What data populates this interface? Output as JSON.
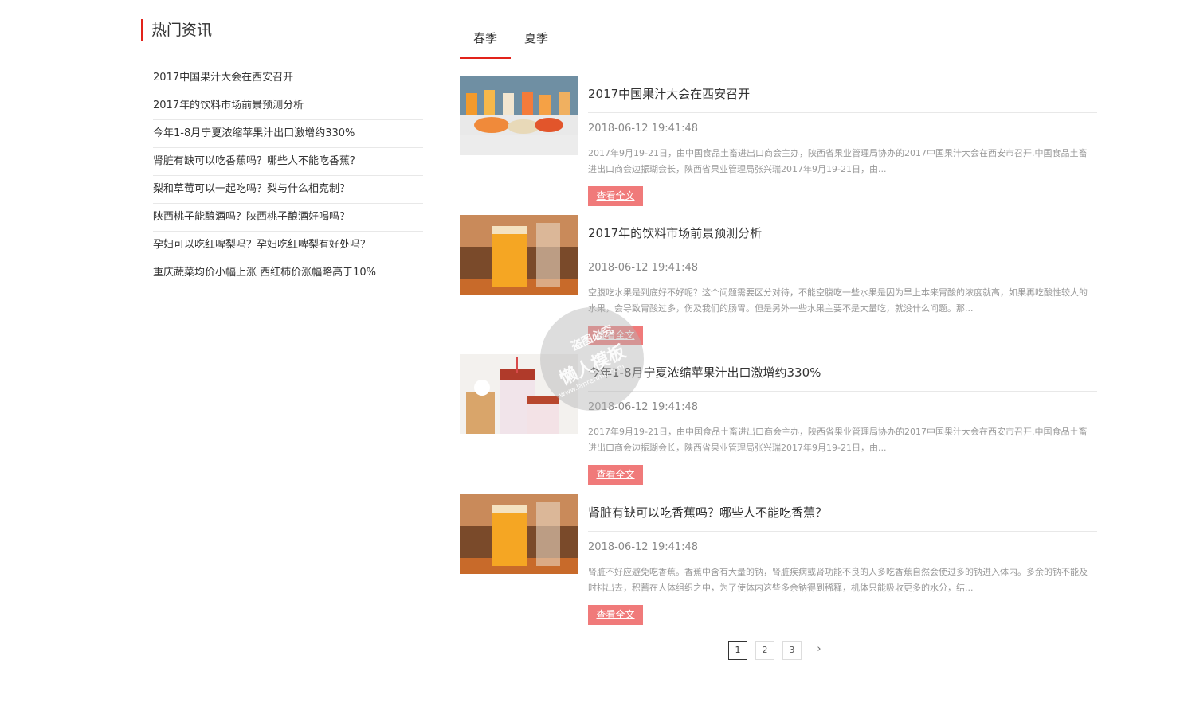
{
  "sidebar": {
    "title": "热门资讯",
    "items": [
      "2017中国果汁大会在西安召开",
      "2017年的饮料市场前景预测分析",
      "今年1-8月宁夏浓缩苹果汁出口激增约330%",
      "肾脏有缺可以吃香蕉吗？哪些人不能吃香蕉？",
      "梨和草莓可以一起吃吗？梨与什么相克制？",
      "陕西桃子能酿酒吗？陕西桃子酿酒好喝吗？",
      "孕妇可以吃红啤梨吗？孕妇吃红啤梨有好处吗？",
      "重庆蔬菜均价小幅上涨 西红柿价涨幅略高于10%"
    ]
  },
  "tabs": [
    "春季",
    "夏季"
  ],
  "articles": [
    {
      "title": "2017中国果汁大会在西安召开",
      "date": "2018-06-12 19:41:48",
      "summary": "2017年9月19-21日，由中国食品土畜进出口商会主办，陕西省果业管理局协办的2017中国果汁大会在西安市召开.中国食品土畜进出口商会边振瑚会长，陕西省果业管理局张兴瑞2017年9月19-21日，由...",
      "button": "查看全文",
      "image": "juice-glasses-fruit-image"
    },
    {
      "title": "2017年的饮料市场前景预测分析",
      "date": "2018-06-12 19:41:48",
      "summary": "空腹吃水果是到底好不好呢？这个问题需要区分对待，不能空腹吃一些水果是因为早上本来胃酸的浓度就高，如果再吃酸性较大的水果，会导致胃酸过多，伤及我们的肠胃。但是另外一些水果主要不是大量吃，就没什么问题。那...",
      "button": "查看全文",
      "image": "orange-juice-glass-image"
    },
    {
      "title": "今年1-8月宁夏浓缩苹果汁出口激增约330%",
      "date": "2018-06-12 19:41:48",
      "summary": "2017年9月19-21日，由中国食品土畜进出口商会主办，陕西省果业管理局协办的2017中国果汁大会在西安市召开.中国食品土畜进出口商会边振瑚会长，陕西省果业管理局张兴瑞2017年9月19-21日，由...",
      "button": "查看全文",
      "image": "milk-tea-drinks-image"
    },
    {
      "title": "肾脏有缺可以吃香蕉吗？哪些人不能吃香蕉？",
      "date": "2018-06-12 19:41:48",
      "summary": "肾脏不好应避免吃香蕉。香蕉中含有大量的钠，肾脏疾病或肾功能不良的人多吃香蕉自然会使过多的钠进入体内。多余的钠不能及时排出去，积蓄在人体组织之中，为了使体内这些多余钠得到稀释，机体只能吸收更多的水分，结...",
      "button": "查看全文",
      "image": "orange-juice-glass-image"
    }
  ],
  "pagination": {
    "pages": [
      "1",
      "2",
      "3"
    ],
    "current": "1",
    "next": "›"
  },
  "watermark": {
    "line1": "盗图必究",
    "line2": "懒人模板",
    "line3": "www.lanrenmb.com"
  },
  "colors": {
    "accent": "#e2231a",
    "button": "#f07a7a"
  }
}
